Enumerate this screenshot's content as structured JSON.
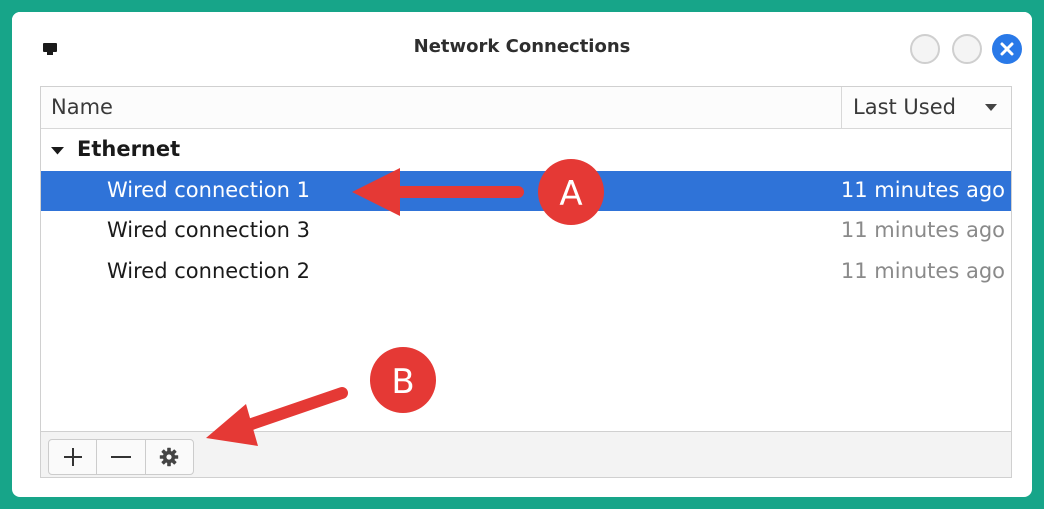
{
  "window": {
    "title": "Network Connections"
  },
  "list": {
    "columns": {
      "name": "Name",
      "last_used": "Last Used"
    },
    "group": {
      "label": "Ethernet"
    },
    "rows": [
      {
        "name": "Wired connection 1",
        "last_used": "11 minutes ago",
        "selected": true
      },
      {
        "name": "Wired connection 3",
        "last_used": "11 minutes ago",
        "selected": false
      },
      {
        "name": "Wired connection 2",
        "last_used": "11 minutes ago",
        "selected": false
      }
    ]
  },
  "toolbar": {
    "buttons": [
      "add-icon",
      "remove-icon",
      "gear-icon"
    ]
  },
  "annotations": {
    "a": "A",
    "b": "B"
  },
  "colors": {
    "background": "#17a589",
    "selection": "#2f73d8",
    "close_button": "#2979e8",
    "annotation_red": "#e53935"
  }
}
